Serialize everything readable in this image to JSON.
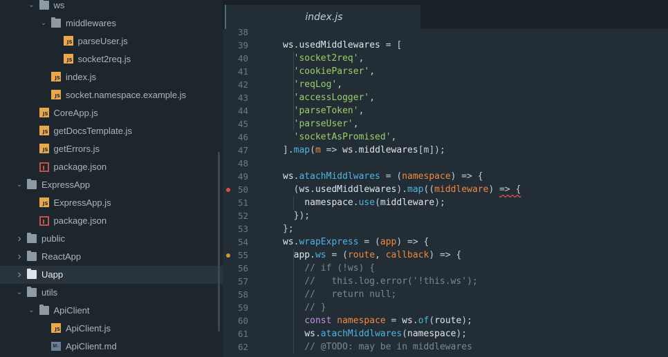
{
  "sidebar": {
    "items": [
      {
        "label": "ws",
        "type": "folder",
        "indent": 1,
        "expanded": true
      },
      {
        "label": "middlewares",
        "type": "folder",
        "indent": 2,
        "expanded": true
      },
      {
        "label": "parseUser.js",
        "type": "js",
        "indent": 3
      },
      {
        "label": "socket2req.js",
        "type": "js",
        "indent": 3
      },
      {
        "label": "index.js",
        "type": "js",
        "indent": 2
      },
      {
        "label": "socket.namespace.example.js",
        "type": "js",
        "indent": 2
      },
      {
        "label": "CoreApp.js",
        "type": "js",
        "indent": 1
      },
      {
        "label": "getDocsTemplate.js",
        "type": "js",
        "indent": 1
      },
      {
        "label": "getErrors.js",
        "type": "js",
        "indent": 1
      },
      {
        "label": "package.json",
        "type": "pkg",
        "indent": 1
      },
      {
        "label": "ExpressApp",
        "type": "folder",
        "indent": 0,
        "expanded": true
      },
      {
        "label": "ExpressApp.js",
        "type": "js",
        "indent": 1
      },
      {
        "label": "package.json",
        "type": "pkg",
        "indent": 1
      },
      {
        "label": "public",
        "type": "folder",
        "indent": 0,
        "expanded": false
      },
      {
        "label": "ReactApp",
        "type": "folder",
        "indent": 0,
        "expanded": false
      },
      {
        "label": "Uapp",
        "type": "folder",
        "indent": 0,
        "expanded": false,
        "selected": true
      },
      {
        "label": "utils",
        "type": "folder",
        "indent": 0,
        "expanded": true
      },
      {
        "label": "ApiClient",
        "type": "folder",
        "indent": 1,
        "expanded": true
      },
      {
        "label": "ApiClient.js",
        "type": "js",
        "indent": 2
      },
      {
        "label": "ApiClient.md",
        "type": "md",
        "indent": 2
      }
    ]
  },
  "tab": {
    "label": "index.js",
    "active": true
  },
  "editor": {
    "lines": [
      {
        "n": "38",
        "tokens": []
      },
      {
        "n": "39",
        "tokens": [
          [
            "var",
            "ws"
          ],
          [
            "pun",
            "."
          ],
          [
            "var",
            "usedMiddlewares"
          ],
          [
            "op",
            " = ["
          ]
        ]
      },
      {
        "n": "40",
        "tokens": [
          [
            "sp",
            "  "
          ],
          [
            "str",
            "'socket2req'"
          ],
          [
            "pun",
            ","
          ]
        ]
      },
      {
        "n": "41",
        "tokens": [
          [
            "sp",
            "  "
          ],
          [
            "str",
            "'cookieParser'"
          ],
          [
            "pun",
            ","
          ]
        ]
      },
      {
        "n": "42",
        "tokens": [
          [
            "sp",
            "  "
          ],
          [
            "str",
            "'reqLog'"
          ],
          [
            "pun",
            ","
          ]
        ]
      },
      {
        "n": "43",
        "tokens": [
          [
            "sp",
            "  "
          ],
          [
            "str",
            "'accessLogger'"
          ],
          [
            "pun",
            ","
          ]
        ]
      },
      {
        "n": "44",
        "tokens": [
          [
            "sp",
            "  "
          ],
          [
            "str",
            "'parseToken'"
          ],
          [
            "pun",
            ","
          ]
        ]
      },
      {
        "n": "45",
        "tokens": [
          [
            "sp",
            "  "
          ],
          [
            "str",
            "'parseUser'"
          ],
          [
            "pun",
            ","
          ]
        ]
      },
      {
        "n": "46",
        "tokens": [
          [
            "sp",
            "  "
          ],
          [
            "str",
            "'socketAsPromised'"
          ],
          [
            "pun",
            ","
          ]
        ]
      },
      {
        "n": "47",
        "tokens": [
          [
            "pun",
            "]."
          ],
          [
            "fn",
            "map"
          ],
          [
            "pun",
            "("
          ],
          [
            "param",
            "m"
          ],
          [
            "op",
            " => "
          ],
          [
            "var",
            "ws"
          ],
          [
            "pun",
            "."
          ],
          [
            "var",
            "middlewares"
          ],
          [
            "pun",
            "[m]);"
          ]
        ]
      },
      {
        "n": "48",
        "tokens": []
      },
      {
        "n": "49",
        "tokens": [
          [
            "var",
            "ws"
          ],
          [
            "pun",
            "."
          ],
          [
            "fn",
            "atachMiddlwares"
          ],
          [
            "op",
            " = ("
          ],
          [
            "param",
            "namespace"
          ],
          [
            "op",
            ") => {"
          ]
        ]
      },
      {
        "n": "50",
        "marker": "error",
        "tokens": [
          [
            "sp",
            "  "
          ],
          [
            "pun",
            "("
          ],
          [
            "var",
            "ws"
          ],
          [
            "pun",
            "."
          ],
          [
            "var",
            "usedMiddlewares"
          ],
          [
            "pun",
            ")."
          ],
          [
            "fn",
            "map"
          ],
          [
            "pun",
            "(("
          ],
          [
            "param",
            "middleware"
          ],
          [
            "pun",
            ") "
          ],
          [
            "sq",
            "=> {"
          ]
        ]
      },
      {
        "n": "51",
        "tokens": [
          [
            "sp",
            "    "
          ],
          [
            "var",
            "namespace"
          ],
          [
            "pun",
            "."
          ],
          [
            "fn",
            "use"
          ],
          [
            "pun",
            "("
          ],
          [
            "var",
            "middleware"
          ],
          [
            "pun",
            ");"
          ]
        ]
      },
      {
        "n": "52",
        "tokens": [
          [
            "sp",
            "  "
          ],
          [
            "pun",
            "});"
          ]
        ]
      },
      {
        "n": "53",
        "tokens": [
          [
            "pun",
            "};"
          ]
        ]
      },
      {
        "n": "54",
        "tokens": [
          [
            "var",
            "ws"
          ],
          [
            "pun",
            "."
          ],
          [
            "fn",
            "wrapExpress"
          ],
          [
            "op",
            " = ("
          ],
          [
            "param",
            "app"
          ],
          [
            "op",
            ") => {"
          ]
        ]
      },
      {
        "n": "55",
        "marker": "warning",
        "tokens": [
          [
            "sp",
            "  "
          ],
          [
            "var",
            "app"
          ],
          [
            "pun",
            "."
          ],
          [
            "fn",
            "ws"
          ],
          [
            "op",
            " = ("
          ],
          [
            "param",
            "route"
          ],
          [
            "pun",
            ", "
          ],
          [
            "param",
            "callback"
          ],
          [
            "op",
            ") => {"
          ]
        ]
      },
      {
        "n": "56",
        "tokens": [
          [
            "sp",
            "    "
          ],
          [
            "cm",
            "// if (!ws) {"
          ]
        ]
      },
      {
        "n": "57",
        "tokens": [
          [
            "sp",
            "    "
          ],
          [
            "cm",
            "//   this.log.error('!this.ws');"
          ]
        ]
      },
      {
        "n": "58",
        "tokens": [
          [
            "sp",
            "    "
          ],
          [
            "cm",
            "//   return null;"
          ]
        ]
      },
      {
        "n": "59",
        "tokens": [
          [
            "sp",
            "    "
          ],
          [
            "cm",
            "// }"
          ]
        ]
      },
      {
        "n": "60",
        "tokens": [
          [
            "sp",
            "    "
          ],
          [
            "kw",
            "const "
          ],
          [
            "param",
            "namespace"
          ],
          [
            "op",
            " = "
          ],
          [
            "var",
            "ws"
          ],
          [
            "pun",
            "."
          ],
          [
            "fn",
            "of"
          ],
          [
            "pun",
            "("
          ],
          [
            "var",
            "route"
          ],
          [
            "pun",
            ");"
          ]
        ]
      },
      {
        "n": "61",
        "tokens": [
          [
            "sp",
            "    "
          ],
          [
            "var",
            "ws"
          ],
          [
            "pun",
            "."
          ],
          [
            "fn",
            "atachMiddlwares"
          ],
          [
            "pun",
            "("
          ],
          [
            "var",
            "namespace"
          ],
          [
            "pun",
            ");"
          ]
        ]
      },
      {
        "n": "62",
        "tokens": [
          [
            "sp",
            "    "
          ],
          [
            "cm",
            "// @TODO: may be in middlewares"
          ]
        ]
      }
    ]
  },
  "colors": {
    "error_marker": "#e04b4b",
    "warning_marker": "#d9952e"
  }
}
